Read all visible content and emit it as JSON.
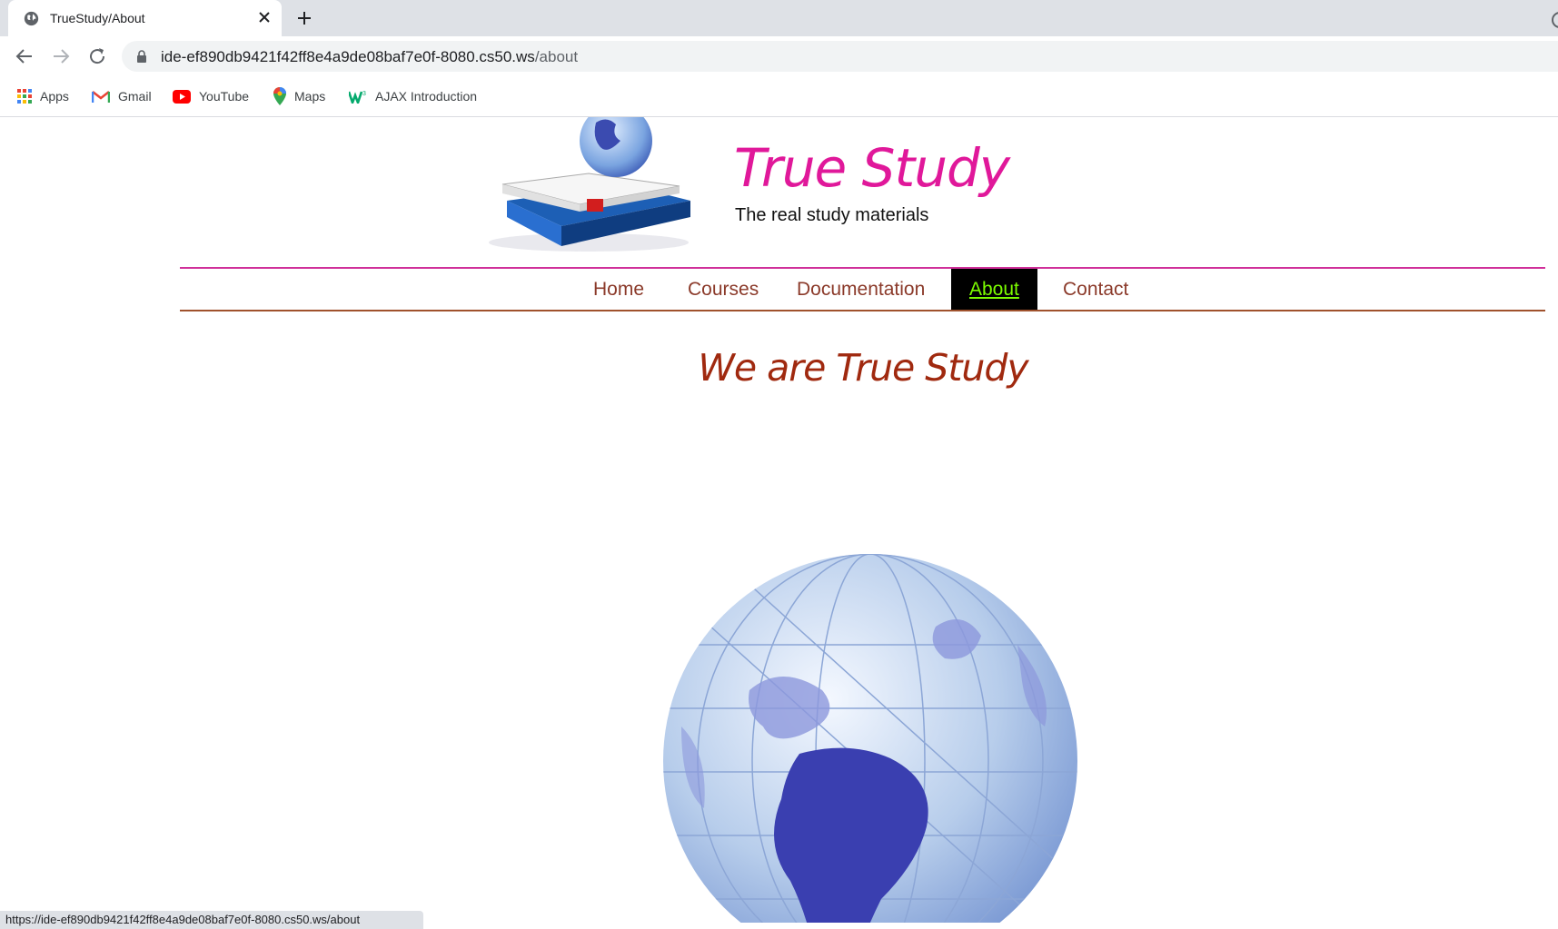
{
  "browser": {
    "tab_title": "TrueStudy/About",
    "url_host": "ide-ef890db9421f42ff8e4a9de08baf7e0f-8080.cs50.ws",
    "url_path": "/about",
    "bookmarks": [
      "Apps",
      "Gmail",
      "YouTube",
      "Maps",
      "AJAX Introduction"
    ],
    "status_url": "https://ide-ef890db9421f42ff8e4a9de08baf7e0f-8080.cs50.ws/about"
  },
  "site": {
    "brand": "True Study",
    "tagline": "The real study materials",
    "brand_color": "#e0189a"
  },
  "nav": {
    "items": [
      "Home",
      "Courses",
      "Documentation",
      "About",
      "Contact"
    ],
    "active": "About"
  },
  "main": {
    "heading": "We are True Study"
  },
  "icons": {
    "favicon": "globe-icon",
    "back": "back-arrow-icon",
    "forward": "forward-arrow-icon",
    "reload": "reload-icon",
    "lock": "lock-icon"
  }
}
